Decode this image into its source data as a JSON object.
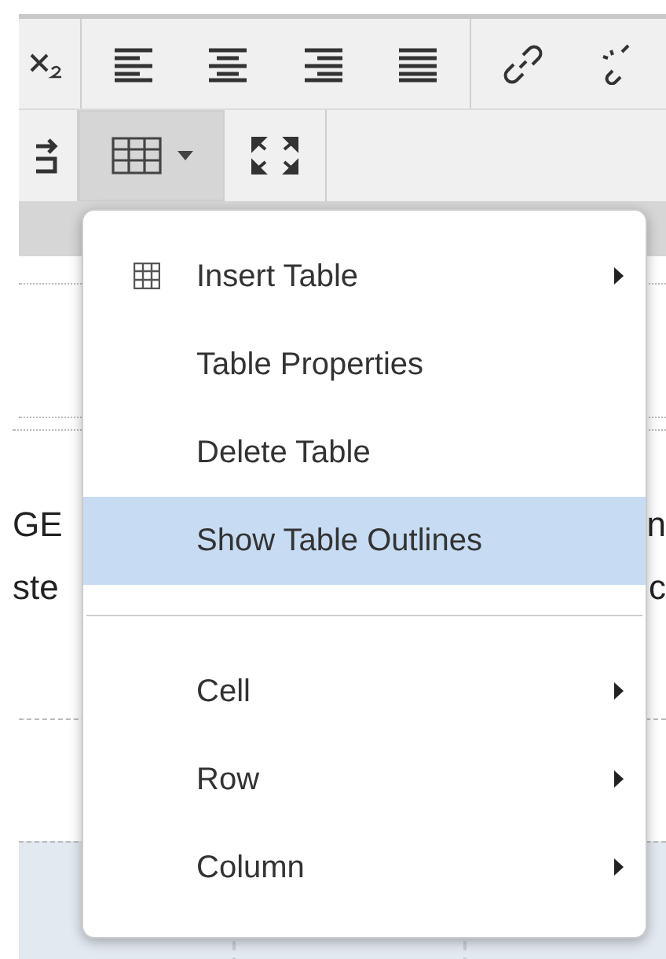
{
  "toolbar": {
    "rows": [
      [
        {
          "kind": "subscript",
          "active": false
        },
        {
          "kind": "separator"
        },
        {
          "kind": "align-left",
          "active": false
        },
        {
          "kind": "align-center",
          "active": false
        },
        {
          "kind": "align-right",
          "active": false
        },
        {
          "kind": "justify",
          "active": false
        },
        {
          "kind": "separator"
        },
        {
          "kind": "link",
          "active": false
        },
        {
          "kind": "unlink",
          "active": false
        }
      ],
      [
        {
          "kind": "indent",
          "active": false
        },
        {
          "kind": "table",
          "active": true
        },
        {
          "kind": "fullscreen",
          "active": false
        }
      ]
    ]
  },
  "editor": {
    "lines": [
      {
        "left": "GE",
        "right": "n"
      },
      {
        "left": "ste",
        "right": "c"
      }
    ]
  },
  "menu": {
    "items": [
      {
        "kind": "icon-item",
        "label": "Insert Table",
        "submenu": true,
        "selected": false
      },
      {
        "kind": "item",
        "label": "Table Properties",
        "submenu": false,
        "selected": false
      },
      {
        "kind": "item",
        "label": "Delete Table",
        "submenu": false,
        "selected": false
      },
      {
        "kind": "item",
        "label": "Show Table Outlines",
        "submenu": false,
        "selected": true
      },
      {
        "kind": "separator"
      },
      {
        "kind": "item",
        "label": "Cell",
        "submenu": true,
        "selected": false
      },
      {
        "kind": "item",
        "label": "Row",
        "submenu": true,
        "selected": false
      },
      {
        "kind": "item",
        "label": "Column",
        "submenu": true,
        "selected": false
      }
    ]
  }
}
